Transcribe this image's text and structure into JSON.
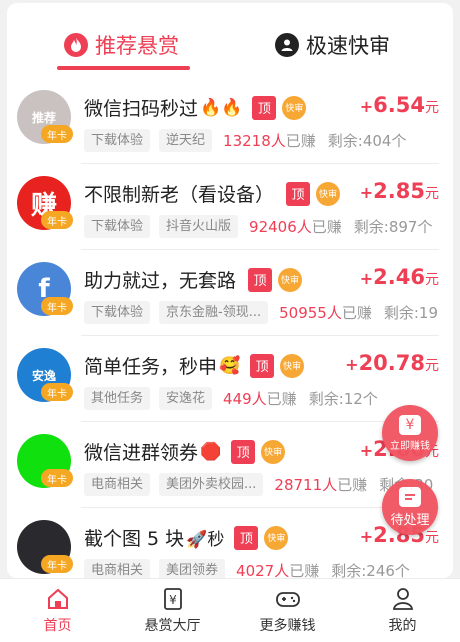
{
  "tabs": [
    {
      "label": "推荐悬赏",
      "icon": "flame-icon",
      "active": true
    },
    {
      "label": "极速快审",
      "icon": "user-circle-icon",
      "active": false
    }
  ],
  "badges": {
    "top": "顶",
    "fast": "快审",
    "card": "年卡"
  },
  "tasks": [
    {
      "title": "微信扫码秒过",
      "emoji": "🔥🔥",
      "tags": [
        "下载体验",
        "逆天纪"
      ],
      "earned_count": "13218人",
      "earned_suffix": "已赚",
      "remain": "剩余:404个",
      "price": "6.54",
      "avatar_color": "#c9c2c0",
      "avatar_label": "推荐"
    },
    {
      "title": "不限制新老（看设备）",
      "emoji": "",
      "tags": [
        "下载体验",
        "抖音火山版"
      ],
      "earned_count": "92406人",
      "earned_suffix": "已赚",
      "remain": "剩余:897个",
      "price": "2.85",
      "avatar_color": "#e8231f",
      "avatar_label": "赚"
    },
    {
      "title": "助力就过，无套路",
      "emoji": "",
      "tags": [
        "下载体验",
        "京东金融-领现..."
      ],
      "earned_count": "50955人",
      "earned_suffix": "已赚",
      "remain": "剩余:19",
      "price": "2.46",
      "avatar_color": "#4a86d8",
      "avatar_label": "f"
    },
    {
      "title": "简单任务，秒申",
      "emoji": "🥰",
      "tags": [
        "其他任务",
        "安逸花"
      ],
      "earned_count": "449人",
      "earned_suffix": "已赚",
      "remain": "剩余:12个",
      "price": "20.78",
      "avatar_color": "#1e7fd3",
      "avatar_label": "安逸"
    },
    {
      "title": "微信进群领券",
      "emoji": "🛑",
      "tags": [
        "电商相关",
        "美团外卖校园..."
      ],
      "earned_count": "28711人",
      "earned_suffix": "已赚",
      "remain": "剩余:30",
      "price": "2.80",
      "avatar_color": "#11e00f",
      "avatar_label": ""
    },
    {
      "title": "截个图 5 块",
      "emoji": "🚀秒",
      "tags": [
        "电商相关",
        "美团领券"
      ],
      "earned_count": "4027人",
      "earned_suffix": "已赚",
      "remain": "剩余:246个",
      "price": "2.85",
      "avatar_color": "#2a2a2e",
      "avatar_label": ""
    }
  ],
  "price_prefix": "+",
  "price_unit": "元",
  "floating": [
    {
      "label": "立即赚钱",
      "icon": "yen-icon"
    },
    {
      "label": "待处理",
      "icon": "chat-icon"
    }
  ],
  "bottom_nav": [
    {
      "label": "首页",
      "icon": "home-icon",
      "active": true
    },
    {
      "label": "悬赏大厅",
      "icon": "yen-tag-icon",
      "active": false
    },
    {
      "label": "更多赚钱",
      "icon": "gamepad-icon",
      "active": false
    },
    {
      "label": "我的",
      "icon": "person-icon",
      "active": false
    }
  ],
  "colors": {
    "accent": "#ee3f55",
    "fast_badge": "#f7a733",
    "float": "#f0535f"
  }
}
